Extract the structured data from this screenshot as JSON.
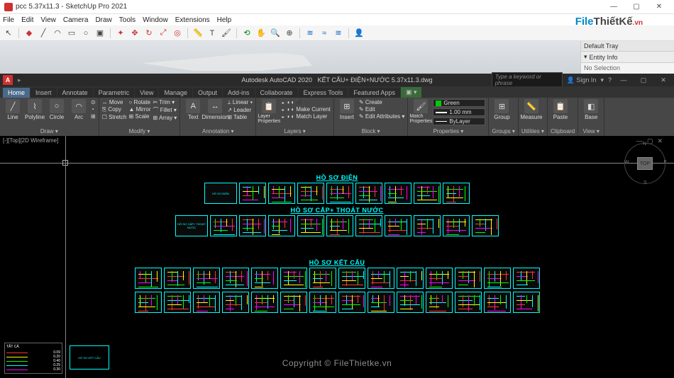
{
  "sketchup": {
    "title": "pcc 5.37x11.3 - SketchUp Pro 2021",
    "menus": [
      "File",
      "Edit",
      "View",
      "Camera",
      "Draw",
      "Tools",
      "Window",
      "Extensions",
      "Help"
    ],
    "tray": {
      "header": "Default Tray",
      "panel": "Entity Info",
      "empty": "No Selection"
    },
    "win_btns": {
      "min": "—",
      "max": "▢",
      "close": "✕"
    }
  },
  "watermark": {
    "part1": "File",
    "part2": "ThiếtKế",
    "suffix": ".vn"
  },
  "acad": {
    "title_app": "Autodesk AutoCAD 2020",
    "title_doc": "KẾT CẤU+ ĐIỆN+NƯỚC 5.37x11.3.dwg",
    "search_ph": "Type a keyword or phrase",
    "signin": "Sign In",
    "tabs": [
      "Home",
      "Insert",
      "Annotate",
      "Parametric",
      "View",
      "Manage",
      "Output",
      "Add-ins",
      "Collaborate",
      "Express Tools",
      "Featured Apps"
    ],
    "panels": {
      "draw": {
        "label": "Draw ▾",
        "items": [
          "Line",
          "Polyline",
          "Circle",
          "Arc"
        ]
      },
      "modify": {
        "label": "Modify ▾",
        "rows": [
          [
            "↔ Move",
            "○ Rotate",
            "✂ Trim ▾"
          ],
          [
            "⎘ Copy",
            "▲ Mirror",
            "⌒ Fillet ▾"
          ],
          [
            "☐ Stretch",
            "⊞ Scale",
            "⊞ Array ▾"
          ]
        ]
      },
      "annotation": {
        "label": "Annotation ▾",
        "big": [
          "Text",
          "Dimension"
        ],
        "rows": [
          "⟂ Linear ▾",
          "↗ Leader",
          "⊞ Table"
        ]
      },
      "layers": {
        "label": "Layers ▾",
        "big": "Layer Properties",
        "rows": [
          "◒ ◑ ◐ ⬛",
          "◒ ◑ ◐ Make Current",
          "◒ ◑ ◐ Match Layer"
        ]
      },
      "block": {
        "label": "Block ▾",
        "big": "Insert",
        "rows": [
          "✎ Create",
          "✎ Edit",
          "✎ Edit Attributes ▾"
        ]
      },
      "properties": {
        "label": "Properties ▾",
        "big": "Match Properties",
        "layer": "Green",
        "lw": "1.00 mm",
        "by": "ByLayer"
      },
      "groups": {
        "label": "Groups ▾",
        "big": "Group"
      },
      "utilities": {
        "label": "Utilities ▾",
        "big": "Measure"
      },
      "clipboard": {
        "label": "Clipboard",
        "big": "Paste"
      },
      "view": {
        "label": "View ▾",
        "big": "Base"
      }
    },
    "viewport_label": "[-][Top][2D Wireframe]",
    "viewcube": {
      "face": "TOP",
      "n": "N",
      "s": "S",
      "e": "E",
      "w": "W"
    },
    "sections": {
      "s1": "HỒ SƠ ĐIỆN",
      "s2": "HỒ SƠ CẤP+ THOÁT NƯỚC",
      "s3": "HỒ SƠ KẾT CẤU"
    },
    "covers": {
      "c1": "HỒ SƠ ĐIỆN",
      "c2": "HỒ SƠ CẤP+ THOÁT NƯỚC",
      "c3": "HỒ SƠ KẾT CẤU"
    },
    "legend": {
      "title": "TẤT CẢ",
      "rows": [
        {
          "color": "#f33",
          "val": "0.09"
        },
        {
          "color": "#ff0",
          "val": "0.20"
        },
        {
          "color": "#0f0",
          "val": "0.40"
        },
        {
          "color": "#0ff",
          "val": "0.25"
        },
        {
          "color": "#f0f",
          "val": "0.30"
        }
      ]
    },
    "watermark_center": "Copyright © FileThietke.vn"
  }
}
